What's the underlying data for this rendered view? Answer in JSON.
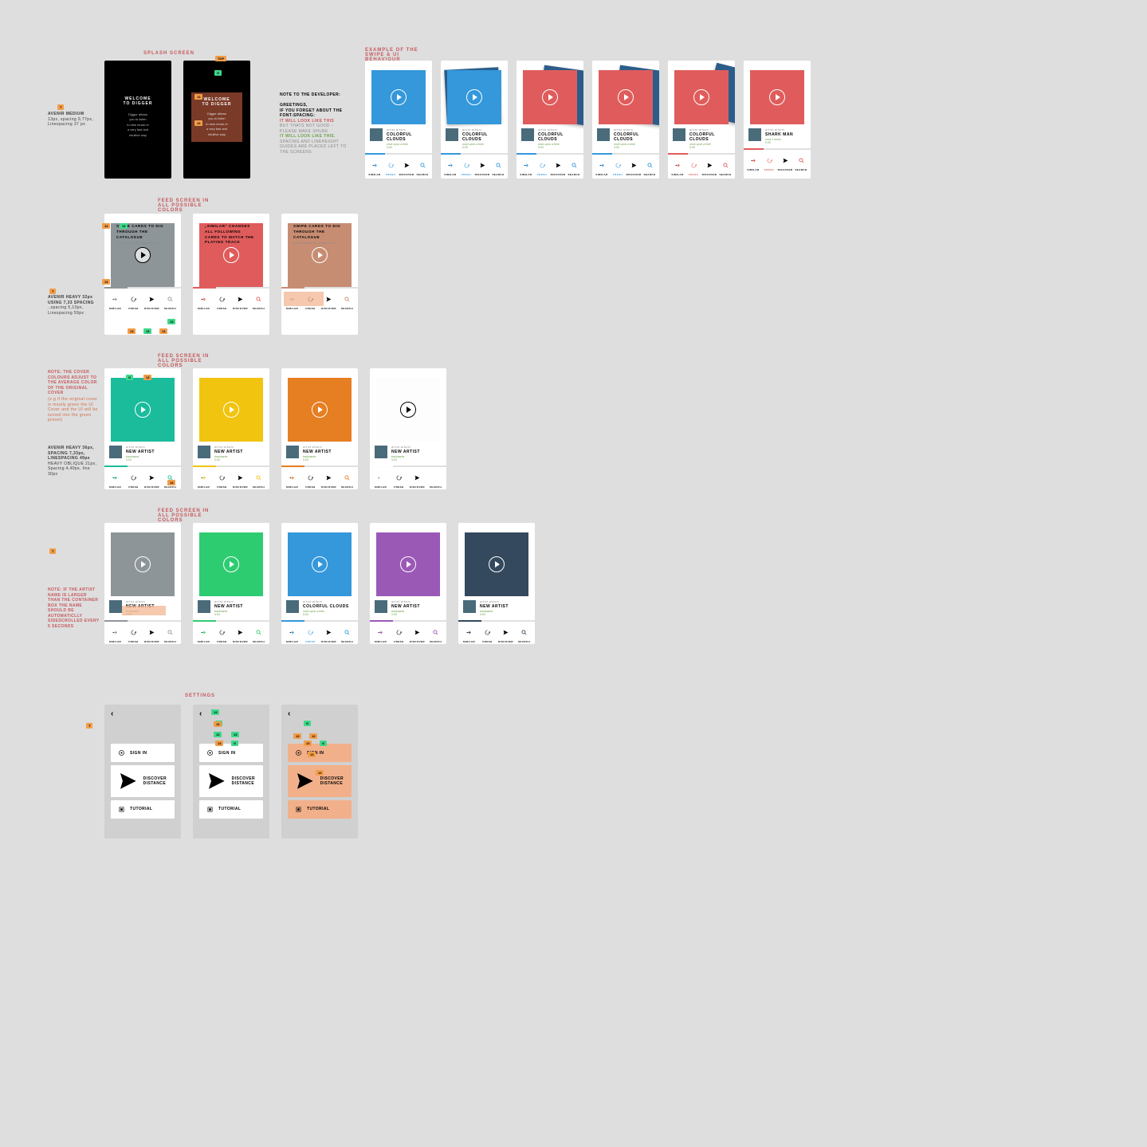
{
  "sections": {
    "splash": "SPLASH SCREEN",
    "swipe": "EXAMPLE OF THE SWIPE & UI BEHAVIOUR",
    "feed1": "FEED SCREEN IN ALL POSSIBLE COLORS",
    "feed2": "FEED SCREEN IN ALL POSSIBLE COLORS",
    "feed3": "FEED SCREEN IN ALL POSSIBLE COLORS",
    "settings": "SETTINGS"
  },
  "splash": {
    "welcome": "WELCOME\nTO DIGGER",
    "body": "Digger allows\nyou to listen\nto new music in\na very fast and\nintuitive way"
  },
  "devnote": {
    "h": "NOTE TO THE DEVELOPER:",
    "l1": "GREETINGS,",
    "l2": "IF YOU FORGET ABOUT THE FONT-SPACING:",
    "l3": "IT WILL LOOK LIKE THIS",
    "l4": "BUT THATS NOT GOOD -",
    "l5": "PLEASE MAKE SHURE",
    "l6": "IT WILL LOOK LIKE THIS.",
    "l7": "SPACING AND LINEHEIGHT GUIDES ARE PLACED LEFT TO THE SCREENS"
  },
  "typo1": {
    "h": "AVENIR MEDIUM",
    "l1": "13px, spacing 9,77px, Linespacing 37 px"
  },
  "typo2": {
    "h": "AVENIR HEAVY 32px USING 7,33 SPACING",
    "l1": "..spacing 5,13px, Linespacing 59px"
  },
  "typo3": {
    "h": "AVENIR HEAVY 36px, SPACING 7,33px, LINESPACING 49px",
    "l1": "HEAVY OBLIQUE 21px, Spacing 4,40px, line 30px"
  },
  "note_color": {
    "h": "NOTE: THE COVER COLOURS ADJUST TO THE AVERAGE COLOR OF THE ORIGINAL COVER",
    "b": "(e.g if the original cover is mostly green the UI Cover and the UI will be turned into the green preset)"
  },
  "note_scroll": {
    "h": "NOTE: IF THE ARTIST NAME IS LARGER THAN THE CONTAINER BOX THE NAME SHOULD BE AUTOMATICLLY SIDESCROLLED EVERY 5 SECONDS"
  },
  "tracks": {
    "colorful": {
      "pre": "artist:album",
      "title": "COLORFUL CLOUDS",
      "sub": "once upon a time",
      "time": "0:00"
    },
    "shark": {
      "pre": "artist:album",
      "title": "SHARK MAN",
      "sub": "once J tunes",
      "time": "0:00"
    },
    "newartist": {
      "pre": "artist:album",
      "title": "NEW ARTIST",
      "sub": "trackname",
      "time": "0:00"
    }
  },
  "feed_msgs": {
    "m1": "SWIPE CARDS TO DIG THROUGH THE CATALOGUE",
    "m1s": "swipe back to rediscover",
    "m2": "„SIMILAR\" CHANGES ALL FOLLOWING CARDS TO MATCH THE PLAYING TRACK",
    "m3": "SWIPE CARDS TO DIG THROUGH THE CATALOGUE",
    "m3s": "swipe back to rediscover"
  },
  "navlabels": [
    "SIMILAR",
    "FRESH",
    "DISCOVER",
    "SEARCH"
  ],
  "settings_items": [
    "SIGN IN",
    "DISCOVER DISTANCE",
    "TUTORIAL"
  ],
  "swipe_colors": [
    "#3498db",
    "#3498db",
    "#e05c5c",
    "#e05c5c",
    "#e05c5c",
    "#e05c5c"
  ],
  "feed1_colors": [
    "#8e9599",
    "#e05c5c",
    "#c78d73"
  ],
  "feed2_colors": [
    "#1abc9c",
    "#f1c40f",
    "#e67e22",
    "#fdfdfd"
  ],
  "feed3_colors": [
    "#8e9599",
    "#2ecc71",
    "#3498db",
    "#9b59b6",
    "#34495e"
  ],
  "progress_colors": [
    "#3498db",
    "#2ecc71",
    "#e67e22",
    "#9b59b6",
    "#e05c5c",
    "#34495e",
    "#d19b7b",
    "#f1c40f",
    "#1abc9c"
  ]
}
